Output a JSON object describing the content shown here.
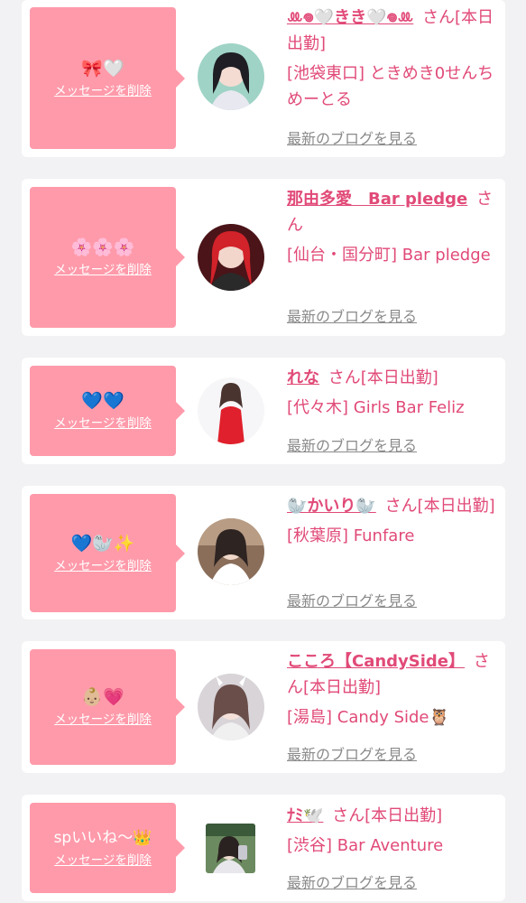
{
  "delete_label": "メッセージを削除",
  "blog_label": "最新のブログを見る",
  "cards": [
    {
      "message": "🎀🤍",
      "name": "ꔛ𖦹🤍きき🤍𖦹ꔛ",
      "suffix": "さん[本日出勤]",
      "shop": "[池袋東口] ときめき0せんちめーとる"
    },
    {
      "message": "🌸🌸🌸",
      "name": "那由多愛　Bar pledge",
      "suffix": "さん",
      "shop": "[仙台・国分町] Bar pledge"
    },
    {
      "message": "💙💙",
      "name": "れな",
      "suffix": "さん[本日出勤]",
      "shop": "[代々木] Girls Bar Feliz"
    },
    {
      "message": "💙🦭✨",
      "name": "🦭かいり🦭",
      "suffix": "さん[本日出勤]",
      "shop": "[秋葉原] Funfare"
    },
    {
      "message": "👶🏼💗",
      "name": "こころ【CandySide】",
      "suffix": "さん[本日出勤]",
      "shop": "[湯島] Candy Side🦉"
    },
    {
      "message": "spいいね〜👑",
      "name": "ﾅﾐ🕊️",
      "suffix": "さん[本日出勤]",
      "shop": "[渋谷] Bar Aventure"
    }
  ]
}
